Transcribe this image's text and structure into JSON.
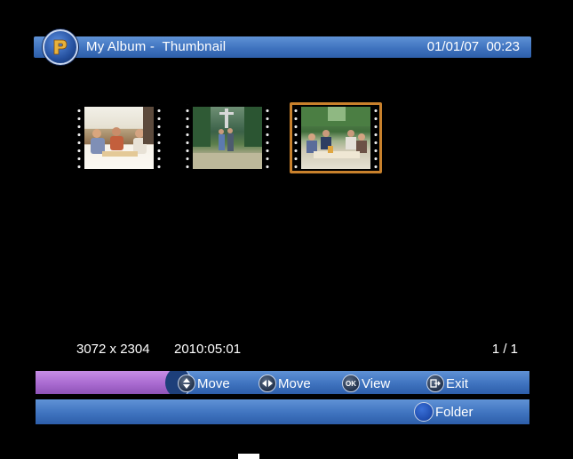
{
  "header": {
    "title": "My Album -  Thumbnail",
    "datetime": "01/01/07  00:23"
  },
  "thumbnails": [
    {
      "selected": false
    },
    {
      "selected": false
    },
    {
      "selected": true
    }
  ],
  "info": {
    "resolution": "3072 x 2304",
    "date": "2010:05:01",
    "page": "1 / 1"
  },
  "help": {
    "move_updown_label": "Move",
    "move_leftright_label": "Move",
    "ok_icon_text": "OK",
    "view_label": "View",
    "exit_label": "Exit",
    "folder_label": "Folder"
  },
  "colors": {
    "title_bar": "#3f73bf",
    "help_accent": "#a96ad0",
    "selection_frame": "#c9812c",
    "folder_button": "#1e4cae"
  }
}
